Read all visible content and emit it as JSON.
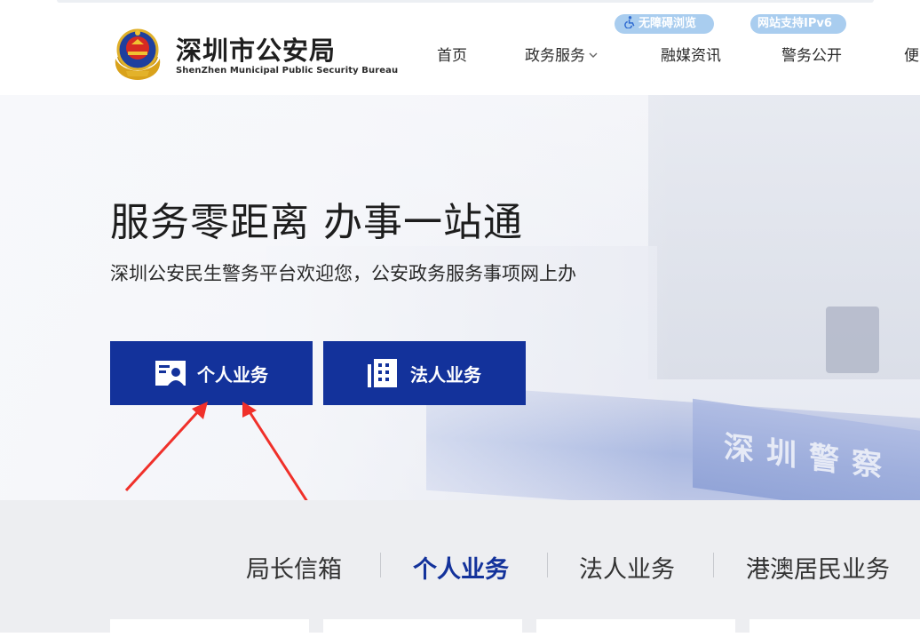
{
  "header": {
    "title": "深圳市公安局",
    "subtitle": "ShenZhen Municipal Public Security Bureau",
    "accessibility_badge": "无障碍浏览",
    "ipv6_badge": "网站支持IPv6",
    "nav": [
      {
        "label": "首页"
      },
      {
        "label": "政务服务"
      },
      {
        "label": "融媒资讯"
      },
      {
        "label": "警务公开"
      },
      {
        "label": "便"
      }
    ]
  },
  "hero": {
    "title": "服务零距离 办事一站通",
    "subtitle": "深圳公安民生警务平台欢迎您，公安政务服务事项网上办",
    "background_text": "深圳警察",
    "buttons": {
      "personal": "个人业务",
      "legal": "法人业务"
    }
  },
  "tabs": [
    {
      "label": "局长信箱",
      "active": false
    },
    {
      "label": "个人业务",
      "active": true
    },
    {
      "label": "法人业务",
      "active": false
    },
    {
      "label": "港澳居民业务",
      "active": false
    }
  ],
  "colors": {
    "primary": "#13329b",
    "badge": "#a9cdef",
    "arrow": "#f0302a",
    "band": "#edeef1"
  }
}
